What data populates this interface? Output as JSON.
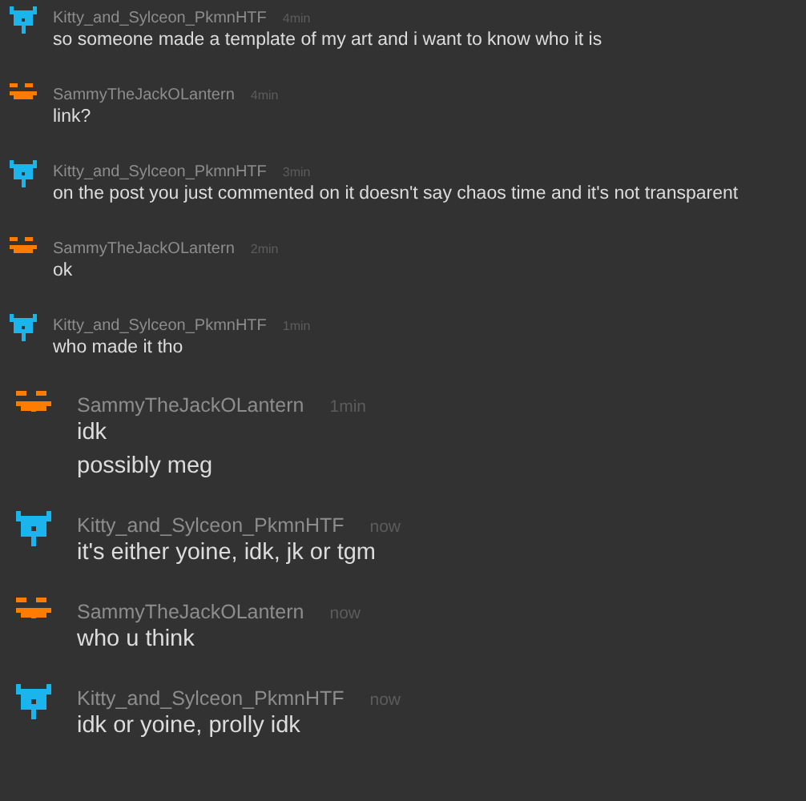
{
  "messages": [
    {
      "user": "Kitty_and_Sylceon_PkmnHTF",
      "time": "4min",
      "kind": "compact",
      "avatar": {
        "kind": "bot",
        "color": "#19b5ec"
      },
      "lines": [
        "so someone made a template of my art and i want to know who it is"
      ]
    },
    {
      "user": "SammyTheJackOLantern",
      "time": "4min",
      "kind": "compact",
      "avatar": {
        "kind": "pumpkin",
        "color": "#ff7c00"
      },
      "lines": [
        "link?"
      ]
    },
    {
      "user": "Kitty_and_Sylceon_PkmnHTF",
      "time": "3min",
      "kind": "compact",
      "avatar": {
        "kind": "bot",
        "color": "#19b5ec"
      },
      "lines": [
        "on the post you just commented on it doesn't say chaos time and it's not transparent"
      ]
    },
    {
      "user": "SammyTheJackOLantern",
      "time": "2min",
      "kind": "compact",
      "avatar": {
        "kind": "pumpkin",
        "color": "#ff7c00"
      },
      "lines": [
        "ok"
      ]
    },
    {
      "user": "Kitty_and_Sylceon_PkmnHTF",
      "time": "1min",
      "kind": "compact",
      "avatar": {
        "kind": "bot",
        "color": "#19b5ec"
      },
      "lines": [
        "who made it tho"
      ]
    },
    {
      "user": "SammyTheJackOLantern",
      "time": "1min",
      "kind": "large",
      "avatar": {
        "kind": "pumpkin",
        "color": "#ff7c00"
      },
      "lines": [
        "idk",
        "possibly meg"
      ]
    },
    {
      "user": "Kitty_and_Sylceon_PkmnHTF",
      "time": "now",
      "kind": "large",
      "avatar": {
        "kind": "bot",
        "color": "#19b5ec"
      },
      "lines": [
        "it's either yoine, idk, jk or tgm"
      ]
    },
    {
      "user": "SammyTheJackOLantern",
      "time": "now",
      "kind": "large",
      "avatar": {
        "kind": "pumpkin",
        "color": "#ff7c00"
      },
      "lines": [
        "who u think"
      ]
    },
    {
      "user": "Kitty_and_Sylceon_PkmnHTF",
      "time": "now",
      "kind": "large",
      "avatar": {
        "kind": "bot",
        "color": "#19b5ec"
      },
      "lines": [
        "idk or yoine, prolly idk"
      ]
    }
  ]
}
